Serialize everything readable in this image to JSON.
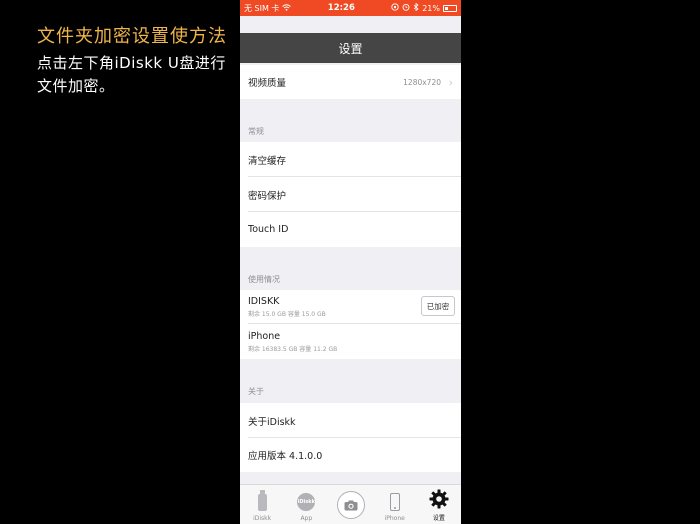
{
  "caption": {
    "title": "文件夹加密设置使方法",
    "body": "点击左下角iDiskk U盘进行文件加密。"
  },
  "status_bar": {
    "carrier": "无 SIM 卡",
    "time": "12:26",
    "battery": "21%"
  },
  "nav": {
    "title": "设置"
  },
  "video_quality": {
    "label": "视频质量",
    "value": "1280x720"
  },
  "section_general": "常规",
  "general_items": [
    "清空缓存",
    "密码保护",
    "Touch ID"
  ],
  "section_usage": "使用情况",
  "usage": [
    {
      "name": "IDISKK",
      "detail": "剩余 15.0 GB 容量 15.0 GB",
      "button": "已加密"
    },
    {
      "name": "iPhone",
      "detail": "剩余 16383.5 GB 容量 11.2 GB"
    }
  ],
  "section_about": "关于",
  "about_items": [
    "关于iDiskk",
    "应用版本 4.1.0.0"
  ],
  "tabs": [
    {
      "label": "iDiskk",
      "icon": "usb-drive-icon"
    },
    {
      "label": "App",
      "icon": "app-logo-icon",
      "badge": "iDiskk"
    },
    {
      "label": "",
      "icon": "camera-icon"
    },
    {
      "label": "iPhone",
      "icon": "phone-icon"
    },
    {
      "label": "设置",
      "icon": "gear-icon"
    }
  ],
  "colors": {
    "status_bar": "#f04a24",
    "nav_bar": "#454545",
    "caption_title": "#f0b64a"
  }
}
